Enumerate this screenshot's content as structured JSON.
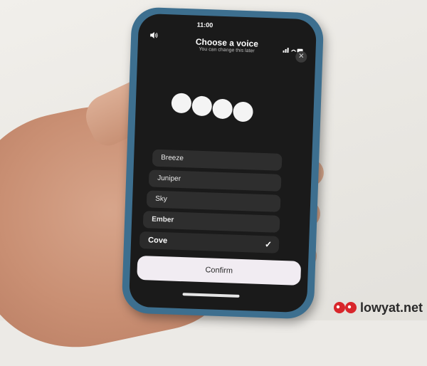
{
  "status": {
    "time": "11:00"
  },
  "dialog": {
    "title": "Choose a voice",
    "subtitle": "You can change this later"
  },
  "voices": [
    {
      "name": "Breeze",
      "selected": false
    },
    {
      "name": "Juniper",
      "selected": false
    },
    {
      "name": "Sky",
      "selected": false
    },
    {
      "name": "Ember",
      "selected": false
    },
    {
      "name": "Cove",
      "selected": true
    }
  ],
  "buttons": {
    "confirm_label": "Confirm"
  },
  "icons": {
    "speaker": "speaker-icon",
    "close": "close-icon",
    "check": "check-icon"
  },
  "watermark": {
    "text": "lowyat.net"
  },
  "colors": {
    "phone_case": "#3d6f8f",
    "screen_bg": "#1a1a1a",
    "list_item_bg": "#2e2e2e",
    "confirm_bg": "#f1ecf2",
    "dot": "#f4f4f4"
  }
}
